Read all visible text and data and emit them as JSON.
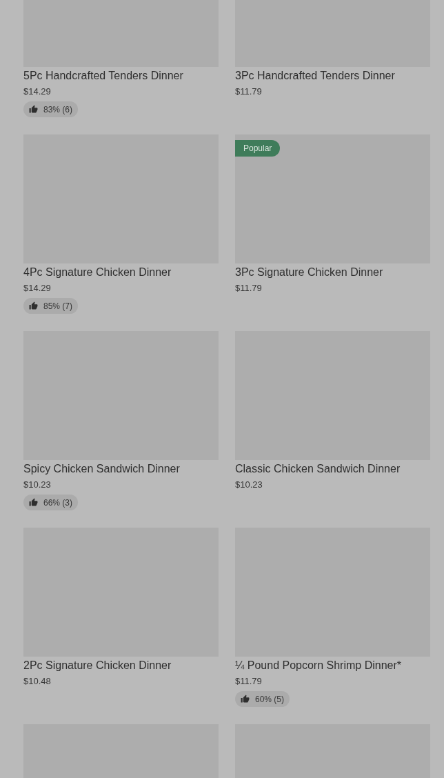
{
  "rows": [
    {
      "items": [
        {
          "kind": "full",
          "name": "5Pc Handcrafted Tenders Dinner",
          "price": "$14.29",
          "rating": "83% (6)"
        },
        {
          "kind": "full",
          "name": "3Pc Handcrafted Tenders Dinner",
          "price": "$11.79"
        }
      ]
    },
    {
      "items": [
        {
          "kind": "full",
          "name": "4Pc Signature Chicken Dinner",
          "price": "$14.29",
          "rating": "85% (7)"
        },
        {
          "kind": "full",
          "badge": "Popular",
          "name": "3Pc Signature Chicken Dinner",
          "price": "$11.79"
        }
      ]
    },
    {
      "items": [
        {
          "kind": "full",
          "name": "Spicy Chicken Sandwich Dinner",
          "price": "$10.23",
          "rating": "66% (3)"
        },
        {
          "kind": "full",
          "name": "Classic Chicken Sandwich Dinner",
          "price": "$10.23"
        }
      ]
    },
    {
      "items": [
        {
          "kind": "full",
          "name": "2Pc Signature Chicken Dinner",
          "price": "$10.48"
        },
        {
          "kind": "full",
          "name": "¼ Pound Popcorn Shrimp Dinner*",
          "price": "$11.79",
          "rating": "60% (5)"
        }
      ]
    },
    {
      "items": [
        {
          "kind": "image_only"
        },
        {
          "kind": "image_only"
        }
      ]
    }
  ]
}
